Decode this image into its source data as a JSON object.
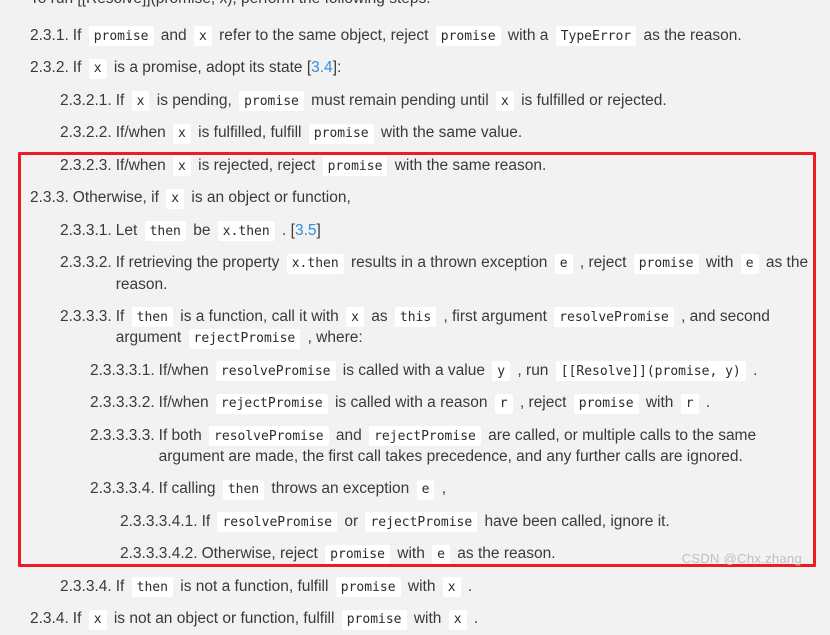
{
  "document": {
    "intro_line": "To run [[Resolve]](promise, x), perform the following steps:",
    "watermark": "CSDN @Chx.zhang",
    "accent_colors": {
      "highlight_border": "#ec1c24",
      "link": "#2f8ee0",
      "page_background": "#f2f2f2",
      "code_background": "#ffffff",
      "text": "#3a3a3a",
      "watermark": "#bfbfbf"
    }
  },
  "items": [
    {
      "id": "2.3.1",
      "marker": "2.3.1.",
      "level": 1,
      "highlighted": false,
      "parts": [
        {
          "t": "text",
          "v": "If "
        },
        {
          "t": "code",
          "v": "promise"
        },
        {
          "t": "text",
          "v": " and "
        },
        {
          "t": "code",
          "v": "x"
        },
        {
          "t": "text",
          "v": " refer to the same object, reject "
        },
        {
          "t": "code",
          "v": "promise"
        },
        {
          "t": "text",
          "v": " with a "
        },
        {
          "t": "code",
          "v": "TypeError"
        },
        {
          "t": "text",
          "v": " as the reason."
        }
      ]
    },
    {
      "id": "2.3.2",
      "marker": "2.3.2.",
      "level": 1,
      "highlighted": false,
      "parts": [
        {
          "t": "text",
          "v": "If "
        },
        {
          "t": "code",
          "v": "x"
        },
        {
          "t": "text",
          "v": " is a promise, adopt its state ["
        },
        {
          "t": "link",
          "v": "3.4"
        },
        {
          "t": "text",
          "v": "]:"
        }
      ]
    },
    {
      "id": "2.3.2.1",
      "marker": "2.3.2.1.",
      "level": 2,
      "highlighted": false,
      "parts": [
        {
          "t": "text",
          "v": "If "
        },
        {
          "t": "code",
          "v": "x"
        },
        {
          "t": "text",
          "v": " is pending, "
        },
        {
          "t": "code",
          "v": "promise"
        },
        {
          "t": "text",
          "v": " must remain pending until "
        },
        {
          "t": "code",
          "v": "x"
        },
        {
          "t": "text",
          "v": " is fulfilled or rejected."
        }
      ]
    },
    {
      "id": "2.3.2.2",
      "marker": "2.3.2.2.",
      "level": 2,
      "highlighted": false,
      "parts": [
        {
          "t": "text",
          "v": "If/when "
        },
        {
          "t": "code",
          "v": "x"
        },
        {
          "t": "text",
          "v": " is fulfilled, fulfill "
        },
        {
          "t": "code",
          "v": "promise"
        },
        {
          "t": "text",
          "v": " with the same value."
        }
      ]
    },
    {
      "id": "2.3.2.3",
      "marker": "2.3.2.3.",
      "level": 2,
      "highlighted": false,
      "parts": [
        {
          "t": "text",
          "v": "If/when "
        },
        {
          "t": "code",
          "v": "x"
        },
        {
          "t": "text",
          "v": " is rejected, reject "
        },
        {
          "t": "code",
          "v": "promise"
        },
        {
          "t": "text",
          "v": " with the same reason."
        }
      ]
    },
    {
      "id": "2.3.3",
      "marker": "2.3.3.",
      "level": 1,
      "highlighted": true,
      "parts": [
        {
          "t": "text",
          "v": "Otherwise, if "
        },
        {
          "t": "code",
          "v": "x"
        },
        {
          "t": "text",
          "v": " is an object or function,"
        }
      ]
    },
    {
      "id": "2.3.3.1",
      "marker": "2.3.3.1.",
      "level": 2,
      "highlighted": true,
      "parts": [
        {
          "t": "text",
          "v": "Let "
        },
        {
          "t": "code",
          "v": "then"
        },
        {
          "t": "text",
          "v": " be "
        },
        {
          "t": "code",
          "v": "x.then"
        },
        {
          "t": "text",
          "v": " . ["
        },
        {
          "t": "link",
          "v": "3.5"
        },
        {
          "t": "text",
          "v": "]"
        }
      ]
    },
    {
      "id": "2.3.3.2",
      "marker": "2.3.3.2.",
      "level": 2,
      "highlighted": true,
      "parts": [
        {
          "t": "text",
          "v": "If retrieving the property "
        },
        {
          "t": "code",
          "v": "x.then"
        },
        {
          "t": "text",
          "v": " results in a thrown exception "
        },
        {
          "t": "code",
          "v": "e"
        },
        {
          "t": "text",
          "v": " , reject "
        },
        {
          "t": "code",
          "v": "promise"
        },
        {
          "t": "text",
          "v": " with "
        },
        {
          "t": "code",
          "v": "e"
        },
        {
          "t": "text",
          "v": " as the reason."
        }
      ]
    },
    {
      "id": "2.3.3.3",
      "marker": "2.3.3.3.",
      "level": 2,
      "highlighted": true,
      "parts": [
        {
          "t": "text",
          "v": "If "
        },
        {
          "t": "code",
          "v": "then"
        },
        {
          "t": "text",
          "v": " is a function, call it with "
        },
        {
          "t": "code",
          "v": "x"
        },
        {
          "t": "text",
          "v": " as "
        },
        {
          "t": "code",
          "v": "this"
        },
        {
          "t": "text",
          "v": " , first argument "
        },
        {
          "t": "code",
          "v": "resolvePromise"
        },
        {
          "t": "text",
          "v": " , and second argument "
        },
        {
          "t": "code",
          "v": "rejectPromise"
        },
        {
          "t": "text",
          "v": " , where:"
        }
      ]
    },
    {
      "id": "2.3.3.3.1",
      "marker": "2.3.3.3.1.",
      "level": 3,
      "highlighted": true,
      "parts": [
        {
          "t": "text",
          "v": "If/when "
        },
        {
          "t": "code",
          "v": "resolvePromise"
        },
        {
          "t": "text",
          "v": " is called with a value "
        },
        {
          "t": "code",
          "v": "y"
        },
        {
          "t": "text",
          "v": " , run "
        },
        {
          "t": "code",
          "v": "[[Resolve]](promise, y)"
        },
        {
          "t": "text",
          "v": " ."
        }
      ]
    },
    {
      "id": "2.3.3.3.2",
      "marker": "2.3.3.3.2.",
      "level": 3,
      "highlighted": true,
      "parts": [
        {
          "t": "text",
          "v": "If/when "
        },
        {
          "t": "code",
          "v": "rejectPromise"
        },
        {
          "t": "text",
          "v": " is called with a reason "
        },
        {
          "t": "code",
          "v": "r"
        },
        {
          "t": "text",
          "v": " , reject "
        },
        {
          "t": "code",
          "v": "promise"
        },
        {
          "t": "text",
          "v": " with "
        },
        {
          "t": "code",
          "v": "r"
        },
        {
          "t": "text",
          "v": " ."
        }
      ]
    },
    {
      "id": "2.3.3.3.3",
      "marker": "2.3.3.3.3.",
      "level": 3,
      "highlighted": true,
      "parts": [
        {
          "t": "text",
          "v": "If both "
        },
        {
          "t": "code",
          "v": "resolvePromise"
        },
        {
          "t": "text",
          "v": " and "
        },
        {
          "t": "code",
          "v": "rejectPromise"
        },
        {
          "t": "text",
          "v": " are called, or multiple calls to the same argument are made, the first call takes precedence, and any further calls are ignored."
        }
      ]
    },
    {
      "id": "2.3.3.3.4",
      "marker": "2.3.3.3.4.",
      "level": 3,
      "highlighted": true,
      "parts": [
        {
          "t": "text",
          "v": "If calling "
        },
        {
          "t": "code",
          "v": "then"
        },
        {
          "t": "text",
          "v": " throws an exception "
        },
        {
          "t": "code",
          "v": "e"
        },
        {
          "t": "text",
          "v": " ,"
        }
      ]
    },
    {
      "id": "2.3.3.3.4.1",
      "marker": "2.3.3.3.4.1.",
      "level": 4,
      "highlighted": true,
      "parts": [
        {
          "t": "text",
          "v": "If "
        },
        {
          "t": "code",
          "v": "resolvePromise"
        },
        {
          "t": "text",
          "v": " or "
        },
        {
          "t": "code",
          "v": "rejectPromise"
        },
        {
          "t": "text",
          "v": " have been called, ignore it."
        }
      ]
    },
    {
      "id": "2.3.3.3.4.2",
      "marker": "2.3.3.3.4.2.",
      "level": 4,
      "highlighted": true,
      "parts": [
        {
          "t": "text",
          "v": "Otherwise, reject "
        },
        {
          "t": "code",
          "v": "promise"
        },
        {
          "t": "text",
          "v": " with "
        },
        {
          "t": "code",
          "v": "e"
        },
        {
          "t": "text",
          "v": " as the reason."
        }
      ]
    },
    {
      "id": "2.3.3.4",
      "marker": "2.3.3.4.",
      "level": 2,
      "highlighted": true,
      "parts": [
        {
          "t": "text",
          "v": "If "
        },
        {
          "t": "code",
          "v": "then"
        },
        {
          "t": "text",
          "v": " is not a function, fulfill "
        },
        {
          "t": "code",
          "v": "promise"
        },
        {
          "t": "text",
          "v": " with "
        },
        {
          "t": "code",
          "v": "x"
        },
        {
          "t": "text",
          "v": " ."
        }
      ]
    },
    {
      "id": "2.3.4",
      "marker": "2.3.4.",
      "level": 1,
      "highlighted": true,
      "parts": [
        {
          "t": "text",
          "v": "If "
        },
        {
          "t": "code",
          "v": "x"
        },
        {
          "t": "text",
          "v": " is not an object or function, fulfill "
        },
        {
          "t": "code",
          "v": "promise"
        },
        {
          "t": "text",
          "v": " with "
        },
        {
          "t": "code",
          "v": "x"
        },
        {
          "t": "text",
          "v": " ."
        }
      ]
    }
  ]
}
